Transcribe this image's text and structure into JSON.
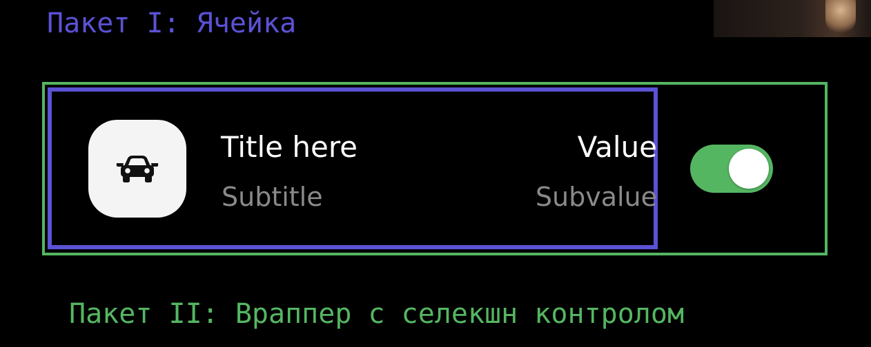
{
  "headings": {
    "cell_package": "Пакет I: Ячейка",
    "wrapper_package": "Пакет II: Враппер с селекшн контролом"
  },
  "cell": {
    "icon": "car-icon",
    "title": "Title here",
    "subtitle": "Subtitle",
    "value": "Value",
    "subvalue": "Subvalue"
  },
  "toggle": {
    "state": "on"
  },
  "colors": {
    "cell_frame": "#5b52d6",
    "wrapper_frame": "#55b662",
    "toggle_on": "#55b662",
    "background": "#000000",
    "secondary_text": "#8a8a8a"
  }
}
